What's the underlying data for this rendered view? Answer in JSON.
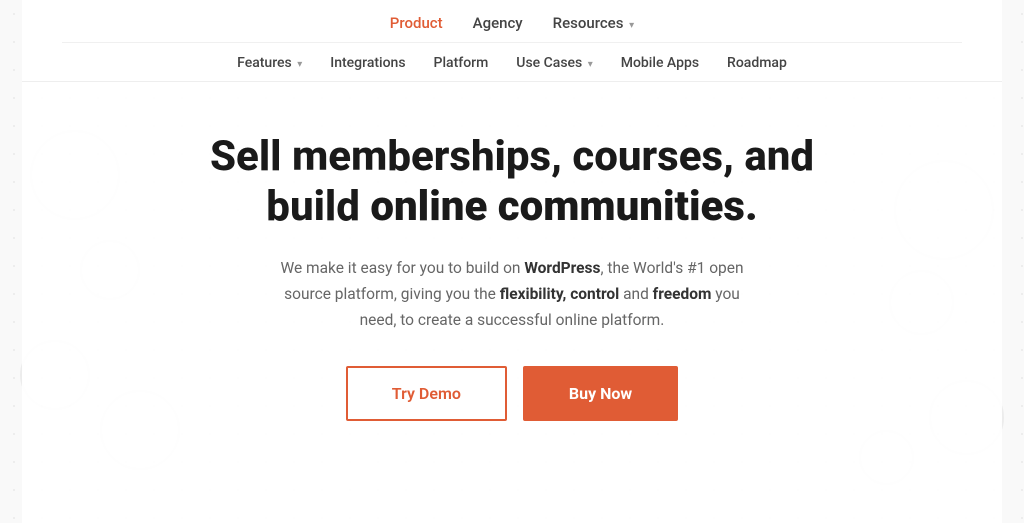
{
  "nav": {
    "top": [
      {
        "label": "Product",
        "active": true,
        "has_dropdown": false
      },
      {
        "label": "Agency",
        "active": false,
        "has_dropdown": false
      },
      {
        "label": "Resources",
        "active": false,
        "has_dropdown": true
      }
    ],
    "bottom": [
      {
        "label": "Features",
        "has_dropdown": true
      },
      {
        "label": "Integrations",
        "has_dropdown": false
      },
      {
        "label": "Platform",
        "has_dropdown": false
      },
      {
        "label": "Use Cases",
        "has_dropdown": true
      },
      {
        "label": "Mobile Apps",
        "has_dropdown": false
      },
      {
        "label": "Roadmap",
        "has_dropdown": false
      }
    ]
  },
  "hero": {
    "title_line1": "Sell memberships, courses, and",
    "title_line2_normal": "build ",
    "title_line2_bold": "online communities.",
    "subtitle_part1": "We make it easy for you to build on ",
    "subtitle_wordpress": "WordPress",
    "subtitle_part2": ", the World's #1 open source platform, giving you the ",
    "subtitle_flexibility": "flexibility, control",
    "subtitle_part3": " and ",
    "subtitle_freedom": "freedom",
    "subtitle_part4": " you need, to create a successful online platform.",
    "btn_demo": "Try Demo",
    "btn_buy": "Buy Now"
  },
  "colors": {
    "accent": "#e05c35",
    "text_dark": "#1a1a1a",
    "text_mid": "#444",
    "text_light": "#666"
  }
}
